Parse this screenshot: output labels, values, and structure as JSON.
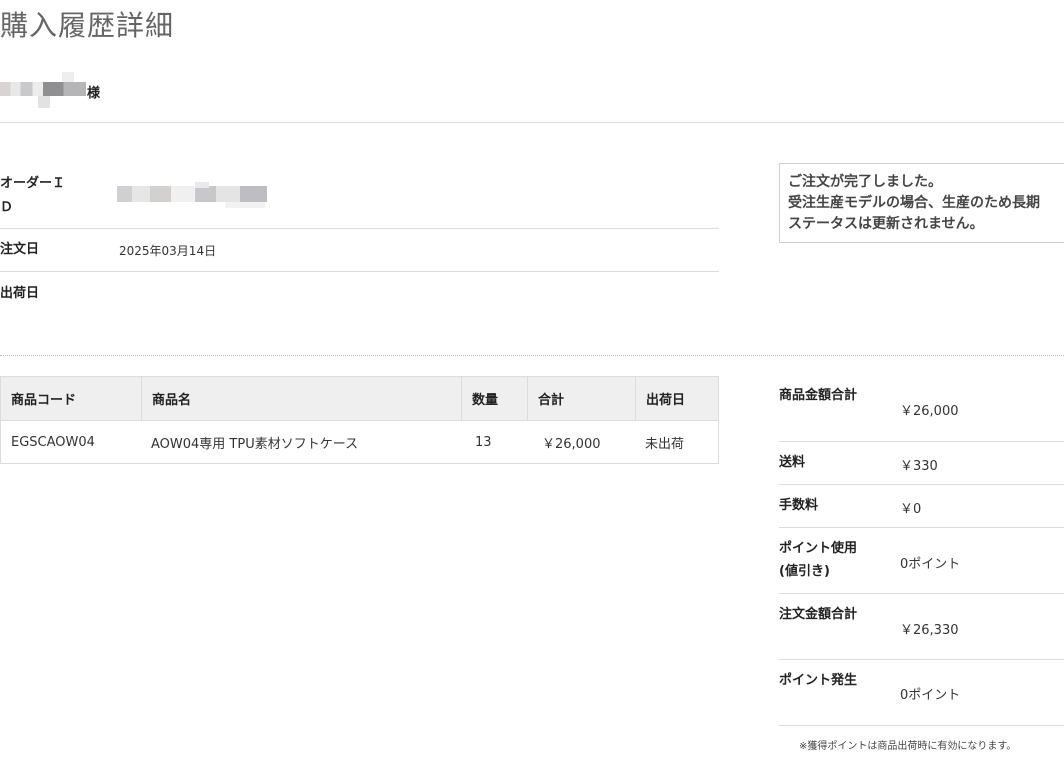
{
  "page": {
    "title": "購入履歴詳細"
  },
  "customer": {
    "honorific": "様"
  },
  "order": {
    "id_label": "オーダーＩＤ",
    "date_label": "注文日",
    "date_value": "2025年03月14日",
    "ship_label": "出荷日",
    "ship_value": ""
  },
  "notice": {
    "line1": "ご注文が完了しました。",
    "line2": "受注生産モデルの場合、生産のため長期",
    "line3": "ステータスは更新されません。"
  },
  "items": {
    "headers": [
      "商品コード",
      "商品名",
      "数量",
      "合計",
      "出荷日"
    ],
    "rows": [
      [
        "EGSCAOW04",
        "AOW04専用 TPU素材ソフトケース",
        "13",
        "￥26,000",
        "未出荷"
      ]
    ]
  },
  "summary": {
    "rows": [
      {
        "label": "商品金額合計",
        "value": "￥26,000"
      },
      {
        "label": "送料",
        "value": "￥330"
      },
      {
        "label": "手数料",
        "value": "￥0"
      },
      {
        "label": "ポイント使用(値引き)",
        "value": "0ポイント"
      },
      {
        "label": "注文金額合計",
        "value": "￥26,330"
      },
      {
        "label": "ポイント発生",
        "value": "0ポイント"
      }
    ],
    "footnote": "※獲得ポイントは商品出荷時に有効になります。"
  }
}
